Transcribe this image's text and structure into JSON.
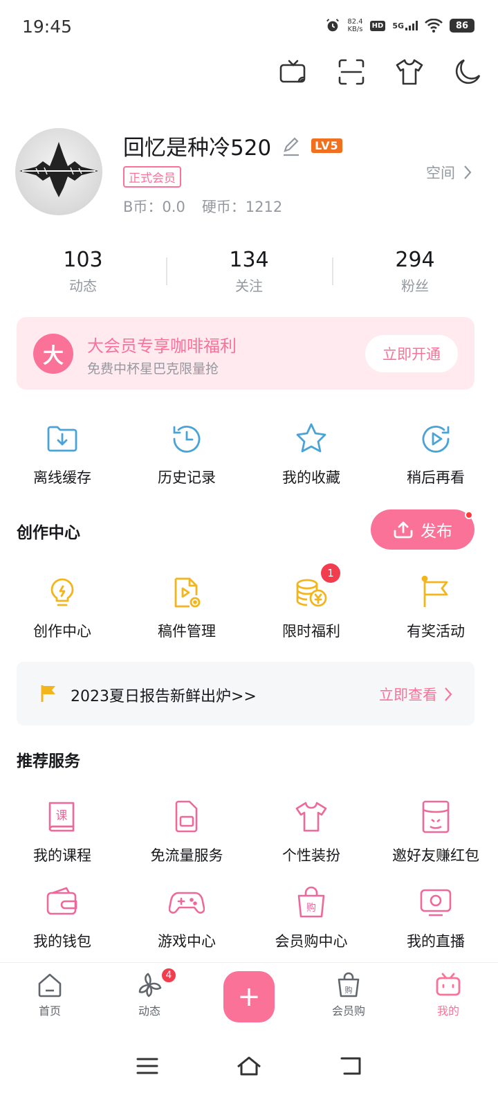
{
  "status": {
    "time": "19:45",
    "speed_value": "82.4",
    "speed_unit": "KB/s",
    "hd": "HD",
    "network": "5G",
    "battery": "86"
  },
  "top_icons": [
    "tv-cast-icon",
    "scan-icon",
    "tshirt-icon",
    "night-mode-icon"
  ],
  "profile": {
    "username": "回忆是种冷520",
    "level": "LV5",
    "vip_badge": "正式会员",
    "bcoin": "B币：0.0",
    "coin": "硬币：1212",
    "space_label": "空间"
  },
  "stats": [
    {
      "value": "103",
      "label": "动态"
    },
    {
      "value": "134",
      "label": "关注"
    },
    {
      "value": "294",
      "label": "粉丝"
    }
  ],
  "vip_banner": {
    "icon_text": "大",
    "title": "大会员专享咖啡福利",
    "subtitle": "免费中杯星巴克限量抢",
    "button": "立即开通"
  },
  "quick_actions": [
    {
      "icon": "download-folder-icon",
      "label": "离线缓存"
    },
    {
      "icon": "history-clock-icon",
      "label": "历史记录"
    },
    {
      "icon": "star-icon",
      "label": "我的收藏"
    },
    {
      "icon": "watch-later-icon",
      "label": "稍后再看"
    }
  ],
  "creator": {
    "title": "创作中心",
    "publish_label": "发布",
    "items": [
      {
        "icon": "lightbulb-icon",
        "label": "创作中心"
      },
      {
        "icon": "manuscript-icon",
        "label": "稿件管理"
      },
      {
        "icon": "coins-icon",
        "label": "限时福利",
        "badge": "1"
      },
      {
        "icon": "flag-icon",
        "label": "有奖活动"
      }
    ]
  },
  "report": {
    "text": "2023夏日报告新鲜出炉>>",
    "action": "立即查看"
  },
  "services": {
    "title": "推荐服务",
    "items": [
      {
        "icon": "course-book-icon",
        "label": "我的课程"
      },
      {
        "icon": "sim-card-icon",
        "label": "免流量服务"
      },
      {
        "icon": "tshirt-icon",
        "label": "个性装扮"
      },
      {
        "icon": "invite-redpacket-icon",
        "label": "邀好友赚红包"
      },
      {
        "icon": "wallet-icon",
        "label": "我的钱包"
      },
      {
        "icon": "gamepad-icon",
        "label": "游戏中心"
      },
      {
        "icon": "shopping-bag-icon",
        "label": "会员购中心"
      },
      {
        "icon": "live-tv-icon",
        "label": "我的直播"
      }
    ]
  },
  "tabs": [
    {
      "label": "首页"
    },
    {
      "label": "动态",
      "badge": "4"
    },
    {
      "label": ""
    },
    {
      "label": "会员购"
    },
    {
      "label": "我的"
    }
  ],
  "colors": {
    "accent": "#fb7299",
    "blue": "#4aa3d6",
    "yellow": "#f3b51c",
    "text": "#18191c",
    "muted": "#9499a0"
  }
}
